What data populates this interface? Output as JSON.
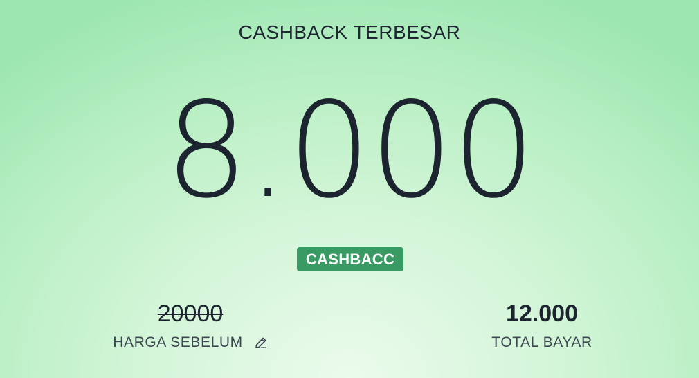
{
  "header": {
    "title": "CASHBACK TERBESAR"
  },
  "cashback": {
    "amount": "8.000",
    "badge": "CASHBACC"
  },
  "price_before": {
    "value": "20000",
    "label": "HARGA SEBELUM",
    "icon": "pencil-icon"
  },
  "total": {
    "value": "12.000",
    "label": "TOTAL BAYAR"
  },
  "colors": {
    "accent": "#3a9a64",
    "text": "#1c2430",
    "background_edge": "#9de6b2",
    "background_center": "#ebfbec"
  }
}
